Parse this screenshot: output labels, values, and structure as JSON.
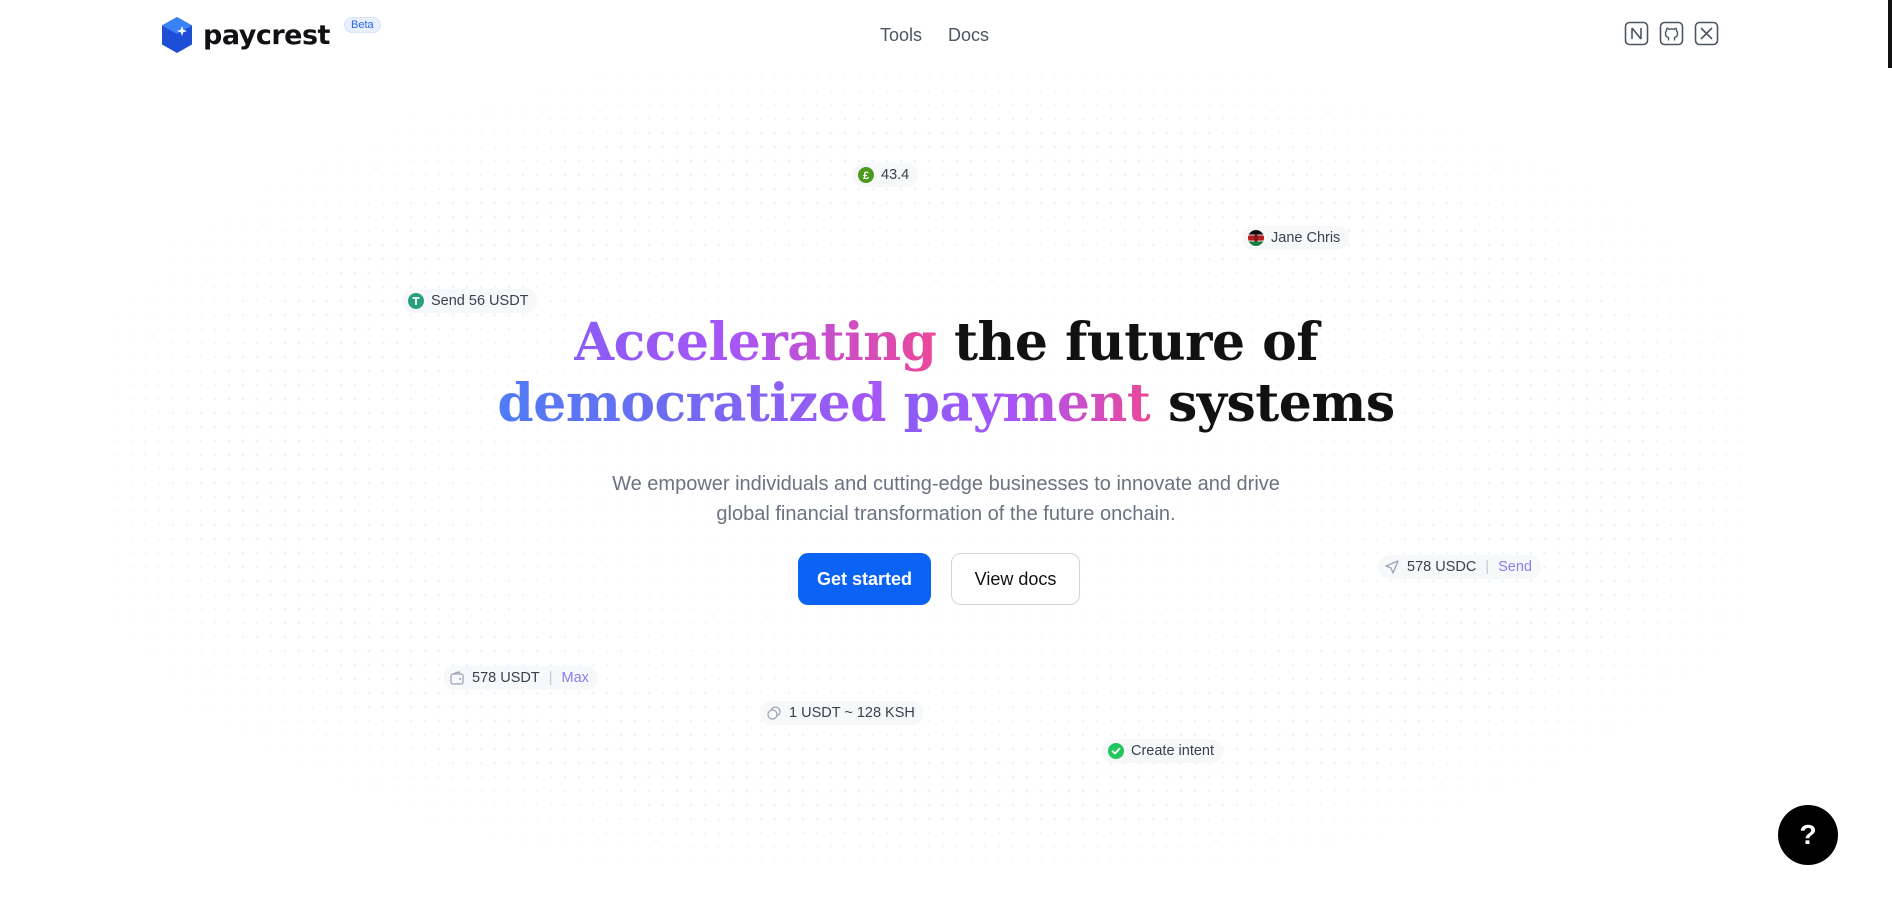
{
  "brand": {
    "name": "paycrest",
    "badge": "Beta",
    "accent": "#0b63f6"
  },
  "nav": {
    "items": [
      {
        "label": "Tools"
      },
      {
        "label": "Docs"
      }
    ]
  },
  "socials": [
    {
      "icon": "notion-icon"
    },
    {
      "icon": "github-icon"
    },
    {
      "icon": "x-icon"
    }
  ],
  "chips": {
    "gbp": {
      "value": "43.4",
      "icon": "pound-icon"
    },
    "contact": {
      "name": "Jane Chris",
      "icon": "kenya-flag-icon"
    },
    "send_usdt": {
      "label": "Send 56 USDT",
      "icon": "tether-icon"
    },
    "usdc": {
      "amount": "578 USDC",
      "action": "Send",
      "icon": "send-icon"
    },
    "usdt_balance": {
      "amount": "578 USDT",
      "action": "Max",
      "icon": "wallet-icon"
    },
    "rate": {
      "label": "1 USDT ~ 128 KSH",
      "icon": "exchange-icon"
    },
    "intent": {
      "label": "Create intent",
      "icon": "check-circle-icon"
    }
  },
  "hero": {
    "title_part1": "Accelerating",
    "title_part2": " the future of",
    "title_part3": "democratized",
    "title_part4": "payment",
    "title_part5": " systems",
    "subtitle_line1": "We empower individuals and cutting-edge businesses to innovate and drive",
    "subtitle_line2": "global financial transformation of the future onchain.",
    "primary_cta": "Get started",
    "secondary_cta": "View docs"
  },
  "help": {
    "label": "?"
  }
}
